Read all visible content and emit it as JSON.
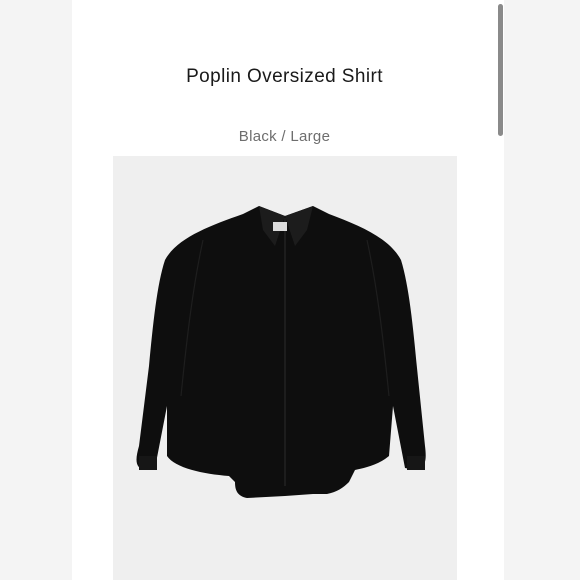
{
  "product": {
    "title": "Poplin Oversized Shirt",
    "variant": "Black / Large",
    "image": {
      "subject": "black oversized poplin shirt",
      "color": "#0e0e0e"
    }
  },
  "colors": {
    "background": "#ffffff",
    "gutter": "#f4f4f4",
    "image_background": "#efefef",
    "scrollbar_thumb": "#8a8a8a"
  }
}
